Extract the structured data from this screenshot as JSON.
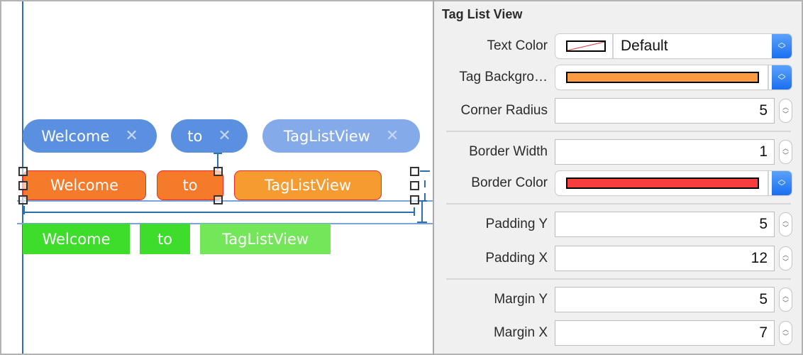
{
  "canvas": {
    "rows": [
      {
        "style": "removable-rounded",
        "tags": [
          {
            "label": "Welcome",
            "close_icon": "✕"
          },
          {
            "label": "to",
            "close_icon": "✕"
          },
          {
            "label": "TagListView",
            "close_icon": "✕",
            "highlighted": true
          }
        ]
      },
      {
        "style": "bordered-orange",
        "selected": true,
        "tags": [
          {
            "label": "Welcome"
          },
          {
            "label": "to"
          },
          {
            "label": "TagListView",
            "highlighted": true
          }
        ]
      },
      {
        "style": "flat-green",
        "tags": [
          {
            "label": "Welcome"
          },
          {
            "label": "to"
          },
          {
            "label": "TagListView",
            "highlighted": true
          }
        ]
      }
    ],
    "colors": {
      "blue": "#5b8fe0",
      "blue_highlighted": "#84aaea",
      "orange": "#f57a2a",
      "orange_highlighted": "#f59b30",
      "orange_border": "#ee2b2b",
      "green": "#3edc2b",
      "green_highlighted": "#74e65a"
    }
  },
  "inspector": {
    "title": "Tag List View",
    "properties": {
      "text_color": {
        "label": "Text Color",
        "value": "Default",
        "swatch": "none"
      },
      "tag_background": {
        "label": "Tag Backgro…",
        "swatch": "#fb9a40"
      },
      "corner_radius": {
        "label": "Corner Radius",
        "value": "5"
      },
      "border_width": {
        "label": "Border Width",
        "value": "1"
      },
      "border_color": {
        "label": "Border Color",
        "swatch": "#f83d3d"
      },
      "padding_y": {
        "label": "Padding Y",
        "value": "5"
      },
      "padding_x": {
        "label": "Padding X",
        "value": "12"
      },
      "margin_y": {
        "label": "Margin Y",
        "value": "5"
      },
      "margin_x": {
        "label": "Margin X",
        "value": "7"
      }
    },
    "icons": {
      "popup_stepper": "⌃⌄",
      "up": "⌃",
      "down": "⌄"
    }
  }
}
